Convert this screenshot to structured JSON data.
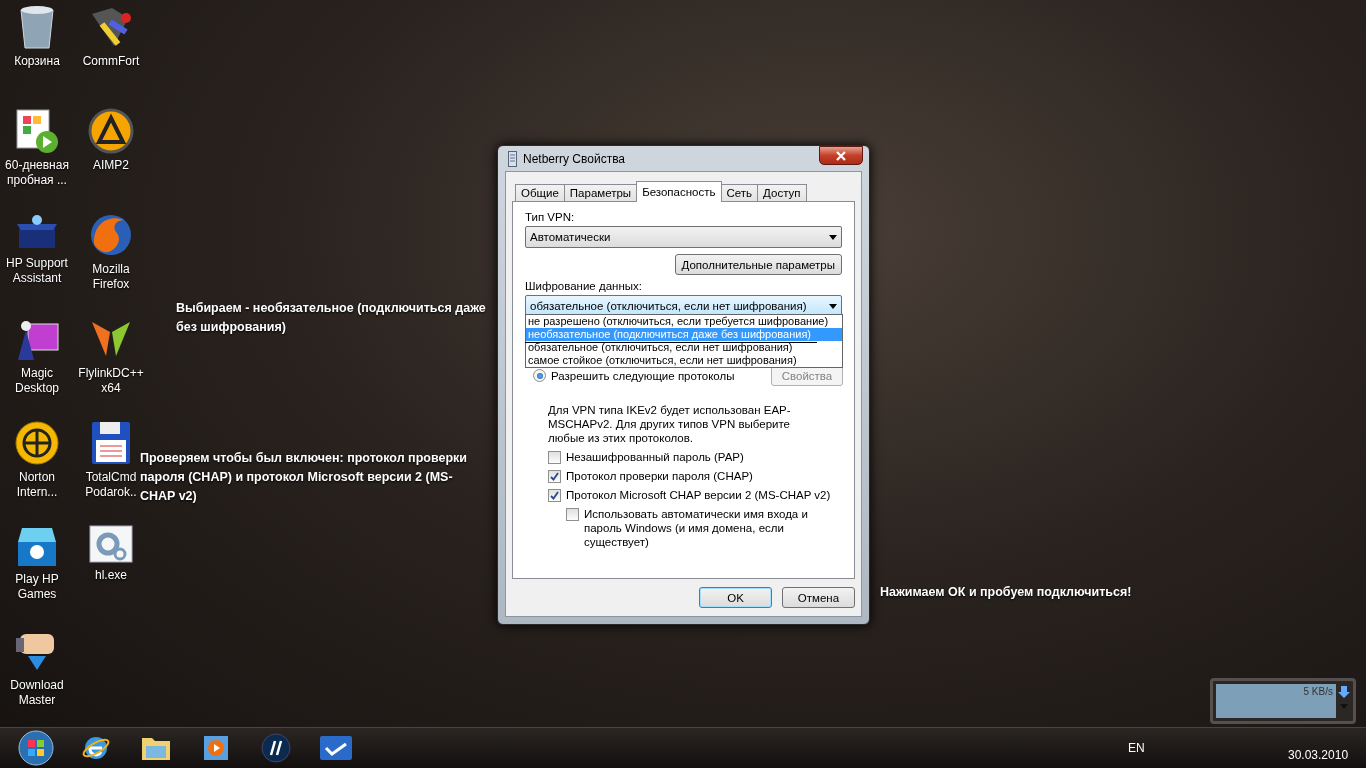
{
  "desktop_icons": [
    {
      "label": "Корзина"
    },
    {
      "label": "60-дневная пробная ..."
    },
    {
      "label": "HP Support Assistant"
    },
    {
      "label": "Magic Desktop"
    },
    {
      "label": "Norton Intern..."
    },
    {
      "label": "Play HP Games"
    },
    {
      "label": "Download Master"
    },
    {
      "label": "CommFort"
    },
    {
      "label": "AIMP2"
    },
    {
      "label": "Mozilla Firefox"
    },
    {
      "label": "FlylinkDC++ x64"
    },
    {
      "label": "TotalCmd Podarok.."
    },
    {
      "label": "hl.exe"
    }
  ],
  "annotations": [
    "Выбираем - необязательное (подключиться даже без шифрования)",
    "Проверяем чтобы был включен: протокол проверки пароля (CHAP) и протокол Microsoft версии 2 (MS-CHAP v2)",
    "Нажимаем ОК и пробуем подключиться!"
  ],
  "dialog": {
    "title": "Netberry Свойства",
    "tabs": [
      {
        "label": "Общие",
        "selected": false
      },
      {
        "label": "Параметры",
        "selected": false
      },
      {
        "label": "Безопасность",
        "selected": true
      },
      {
        "label": "Сеть",
        "selected": false
      },
      {
        "label": "Доступ",
        "selected": false
      }
    ],
    "vpn_type_label": "Тип VPN:",
    "vpn_type_value": "Автоматически",
    "advanced_button": "Дополнительные параметры",
    "encryption_label": "Шифрование данных:",
    "encryption_value": "обязательное (отключиться, если нет шифрования)",
    "encryption_options": [
      {
        "label": "не разрешено (отключиться, если требуется шифрование)",
        "selected": false
      },
      {
        "label": "необязательное (подключиться даже без шифрования)",
        "selected": true
      },
      {
        "label": "обязательное (отключиться, если нет шифрования)",
        "selected": false
      },
      {
        "label": "самое стойкое (отключиться, если нет шифрования)",
        "selected": false
      }
    ],
    "protocols_radio": {
      "label": "Разрешить следующие протоколы",
      "selected": true
    },
    "properties_button": {
      "label": "Свойства",
      "disabled": true
    },
    "info_text": "Для VPN типа IKEv2 будет использован EAP-MSCHAPv2. Для других типов VPN выберите любые из этих протоколов.",
    "protocols": [
      {
        "label": "Незашифрованный пароль (PAP)",
        "checked": false
      },
      {
        "label": "Протокол проверки пароля (CHAP)",
        "checked": true
      },
      {
        "label": "Протокол Microsoft CHAP версии 2 (MS-CHAP v2)",
        "checked": true,
        "children": [
          {
            "label": "Использовать автоматически имя входа и пароль Windows (и имя домена, если существует)",
            "checked": false
          }
        ]
      }
    ],
    "buttons": [
      {
        "label": "OK",
        "selected": true
      },
      {
        "label": "Отмена",
        "selected": false
      }
    ]
  },
  "gadget": {
    "speed": "5 KB/s"
  },
  "taskbar": {
    "language": "EN",
    "date": "30.03.2010"
  }
}
